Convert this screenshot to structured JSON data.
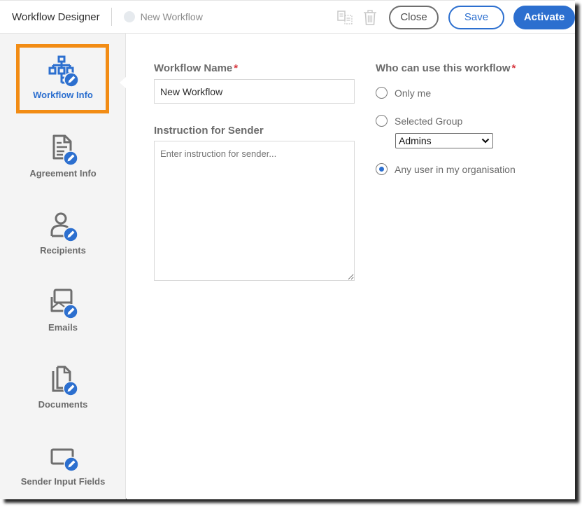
{
  "header": {
    "app_title": "Workflow Designer",
    "workflow_name": "New Workflow",
    "icons": {
      "copy": "copy-icon",
      "delete": "trash-icon"
    },
    "buttons": {
      "close": "Close",
      "save": "Save",
      "activate": "Activate"
    }
  },
  "sidebar": {
    "active_index": 0,
    "items": [
      {
        "label": "Workflow Info",
        "icon": "workflow-tree-icon"
      },
      {
        "label": "Agreement Info",
        "icon": "document-text-icon"
      },
      {
        "label": "Recipients",
        "icon": "user-icon"
      },
      {
        "label": "Emails",
        "icon": "email-icon"
      },
      {
        "label": "Documents",
        "icon": "documents-icon"
      },
      {
        "label": "Sender Input Fields",
        "icon": "input-field-icon"
      }
    ]
  },
  "form": {
    "workflow_name": {
      "label": "Workflow Name",
      "required_mark": "*",
      "value": "New Workflow"
    },
    "instruction": {
      "label": "Instruction for Sender",
      "placeholder": "Enter instruction for sender..."
    },
    "access": {
      "label": "Who can use this workflow",
      "required_mark": "*",
      "options": [
        {
          "label": "Only me",
          "selected": false
        },
        {
          "label": "Selected Group",
          "selected": false
        },
        {
          "label": "Any user in my organisation",
          "selected": true
        }
      ],
      "group_select": {
        "value": "Admins"
      }
    }
  },
  "colors": {
    "accent": "#2c6fcf",
    "highlight_frame": "#f28c14",
    "required": "#d7373f"
  }
}
